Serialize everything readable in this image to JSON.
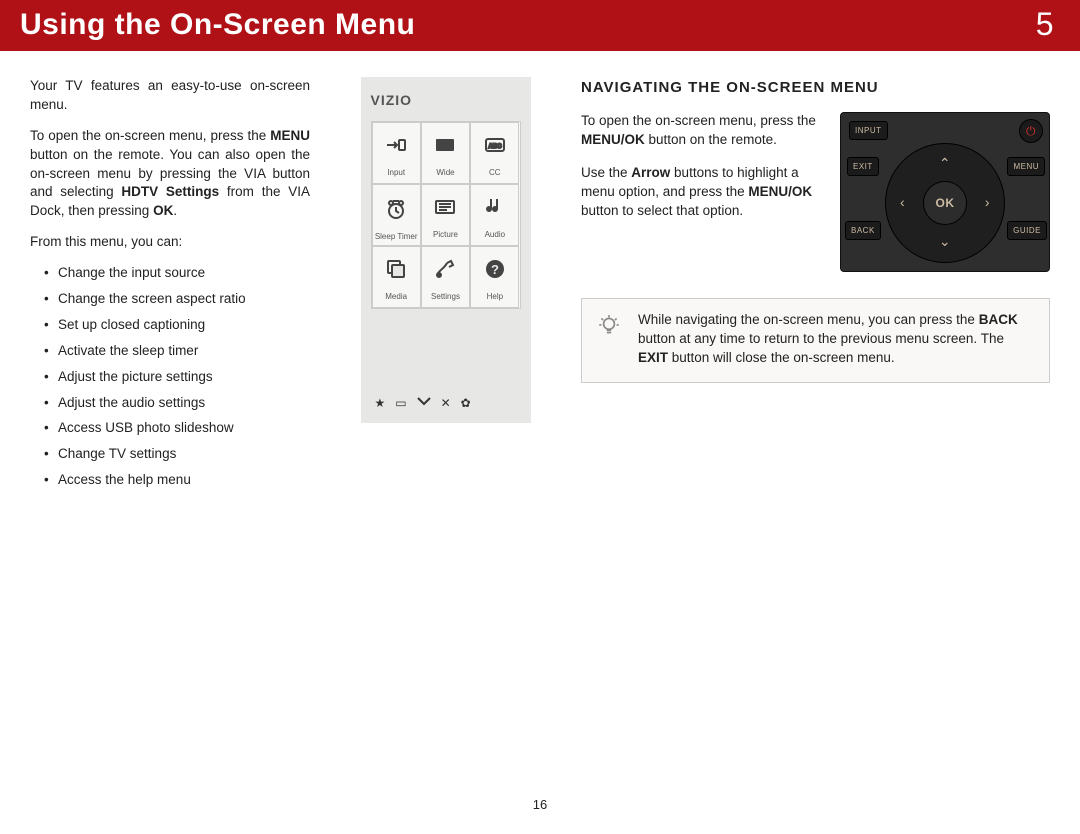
{
  "banner": {
    "title": "Using the On-Screen Menu",
    "chapter": "5"
  },
  "left": {
    "intro": "Your TV features an easy-to-use on-screen menu.",
    "p2_a": "To open the on-screen menu, press the ",
    "p2_b": "MENU",
    "p2_c": " button on the remote. You can also open the on-screen menu by pressing the VIA button and selecting ",
    "p2_d": "HDTV Settings",
    "p2_e": " from the VIA Dock, then pressing ",
    "p2_f": "OK",
    "p2_g": ".",
    "lead": "From this menu, you can:",
    "items": [
      "Change the input source",
      "Change the screen aspect ratio",
      "Set up closed captioning",
      "Activate the sleep timer",
      "Adjust the picture settings",
      "Adjust the audio settings",
      "Access USB photo slideshow",
      "Change TV settings",
      "Access the help menu"
    ]
  },
  "vizio": {
    "logo": "VIZIO",
    "cells": [
      "Input",
      "Wide",
      "CC",
      "Sleep Timer",
      "Picture",
      "Audio",
      "Media",
      "Settings",
      "Help"
    ]
  },
  "right": {
    "heading": "NAVIGATING THE ON-SCREEN MENU",
    "p1_a": "To open the on-screen menu, press the ",
    "p1_b": "MENU/OK",
    "p1_c": " button on the remote.",
    "p2_a": "Use the ",
    "p2_b": "Arrow",
    "p2_c": " buttons to highlight a menu option, and press the ",
    "p2_d": "MENU/OK",
    "p2_e": " button to select that option.",
    "tip_a": "While navigating the on-screen menu, you can press the ",
    "tip_b": "BACK",
    "tip_c": " button at any time to return to the previous menu screen. The ",
    "tip_d": "EXIT",
    "tip_e": " button will close the on-screen menu."
  },
  "remote": {
    "input": "INPUT",
    "exit": "EXIT",
    "menu": "MENU",
    "back": "BACK",
    "guide": "GUIDE",
    "ok": "OK"
  },
  "page_number": "16"
}
